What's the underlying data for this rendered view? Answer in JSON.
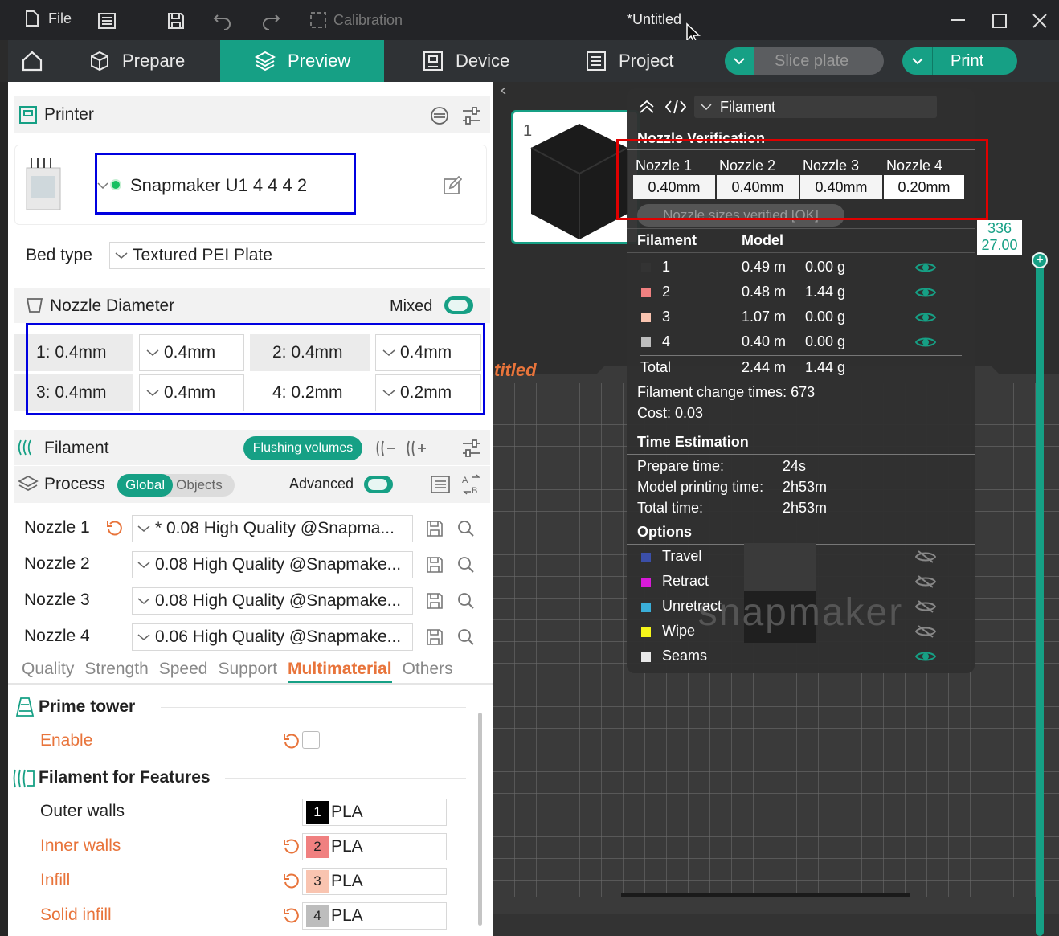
{
  "titlebar": {
    "file": "File",
    "calibration": "Calibration",
    "title": "*Untitled"
  },
  "menu": {
    "prepare": "Prepare",
    "preview": "Preview",
    "device": "Device",
    "project": "Project",
    "slice": "Slice plate",
    "print": "Print"
  },
  "printer": {
    "header": "Printer",
    "name": "Snapmaker U1 4 4 4 2",
    "bed_label": "Bed type",
    "bed_value": "Textured PEI Plate",
    "nozzle_header": "Nozzle Diameter",
    "mixed_label": "Mixed",
    "nozzles": [
      {
        "label": "1: 0.4mm",
        "value": "0.4mm"
      },
      {
        "label": "2: 0.4mm",
        "value": "0.4mm"
      },
      {
        "label": "3: 0.4mm",
        "value": "0.4mm"
      },
      {
        "label": "4: 0.2mm",
        "value": "0.2mm"
      }
    ]
  },
  "filament": {
    "header": "Filament",
    "flushing": "Flushing volumes"
  },
  "process": {
    "header": "Process",
    "global": "Global",
    "objects": "Objects",
    "advanced": "Advanced",
    "presets": [
      {
        "label": "Nozzle 1",
        "value": "* 0.08 High Quality @Snapma..."
      },
      {
        "label": "Nozzle 2",
        "value": "0.08 High Quality @Snapmake..."
      },
      {
        "label": "Nozzle 3",
        "value": "0.08 High Quality @Snapmake..."
      },
      {
        "label": "Nozzle 4",
        "value": "0.06 High Quality @Snapmake..."
      }
    ],
    "tabs": [
      "Quality",
      "Strength",
      "Speed",
      "Support",
      "Multimaterial",
      "Others"
    ],
    "active_tab": "Multimaterial"
  },
  "settings": {
    "prime_tower": "Prime tower",
    "enable": "Enable",
    "filament_features": "Filament for Features",
    "features": [
      {
        "label": "Outer walls",
        "num": "1",
        "mat": "PLA",
        "color": "#000000"
      },
      {
        "label": "Inner walls",
        "num": "2",
        "mat": "PLA",
        "color": "#f08080"
      },
      {
        "label": "Infill",
        "num": "3",
        "mat": "PLA",
        "color": "#f9c4b0"
      },
      {
        "label": "Solid infill",
        "num": "4",
        "mat": "PLA",
        "color": "#bdbdbd"
      }
    ]
  },
  "viewport": {
    "plate_number": "1",
    "plate_name": "titled",
    "slider_top": "336",
    "slider_bottom": "27.00",
    "brand": "snapmaker"
  },
  "panel": {
    "view_mode": "Filament",
    "verify_title": "Nozzle Verification",
    "nozzle_heads": [
      "Nozzle 1",
      "Nozzle 2",
      "Nozzle 3",
      "Nozzle 4"
    ],
    "nozzle_vals": [
      "0.40mm",
      "0.40mm",
      "0.40mm",
      "0.20mm"
    ],
    "verified": "Nozzle sizes verified [OK]",
    "col_filament": "Filament",
    "col_model": "Model",
    "filaments": [
      {
        "id": "1",
        "len": "0.49 m",
        "wt": "0.00 g",
        "color": "#333333"
      },
      {
        "id": "2",
        "len": "0.48 m",
        "wt": "1.44 g",
        "color": "#f08080"
      },
      {
        "id": "3",
        "len": "1.07 m",
        "wt": "0.00 g",
        "color": "#f9c4b0"
      },
      {
        "id": "4",
        "len": "0.40 m",
        "wt": "0.00 g",
        "color": "#bdbdbd"
      }
    ],
    "total_label": "Total",
    "total_len": "2.44 m",
    "total_wt": "1.44 g",
    "change_times": "Filament change times:  673",
    "cost": "Cost:  0.03",
    "time_title": "Time Estimation",
    "prepare_label": "Prepare time:",
    "prepare_val": "24s",
    "model_label": "Model printing time:",
    "model_val": "2h53m",
    "total_time_label": "Total time:",
    "total_time_val": "2h53m",
    "options_title": "Options",
    "options": [
      {
        "label": "Travel",
        "color": "#3b4fa8"
      },
      {
        "label": "Retract",
        "color": "#d81ad8"
      },
      {
        "label": "Unretract",
        "color": "#3aaed8"
      },
      {
        "label": "Wipe",
        "color": "#f5f51a"
      },
      {
        "label": "Seams",
        "color": "#e8e8e8"
      }
    ]
  }
}
